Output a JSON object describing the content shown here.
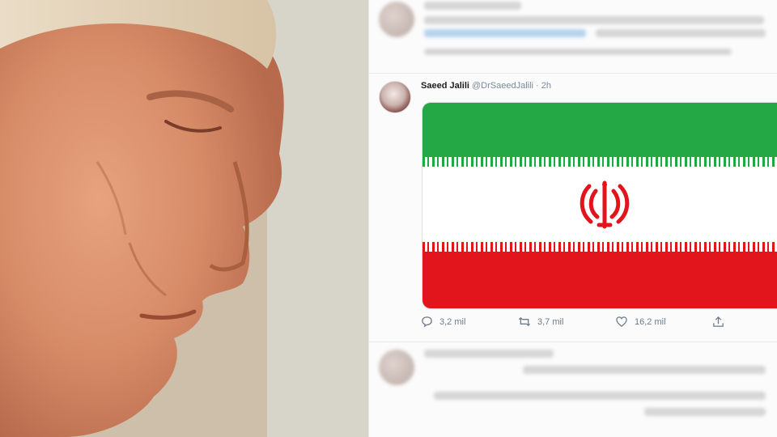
{
  "tweet": {
    "author_name": "Saeed Jalili",
    "handle": "@DrSaeedJalili",
    "separator": "·",
    "time": "2h",
    "flag_colors": [
      "#23a845",
      "#ffffff",
      "#e1151b"
    ],
    "actions": {
      "replies": "3,2 mil",
      "retweets": "3,7 mil",
      "likes": "16,2 mil",
      "share_icon": "share-icon"
    }
  },
  "icons": [
    "comment-icon",
    "retweet-icon",
    "heart-icon",
    "share-icon",
    "iran-emblem-icon"
  ]
}
